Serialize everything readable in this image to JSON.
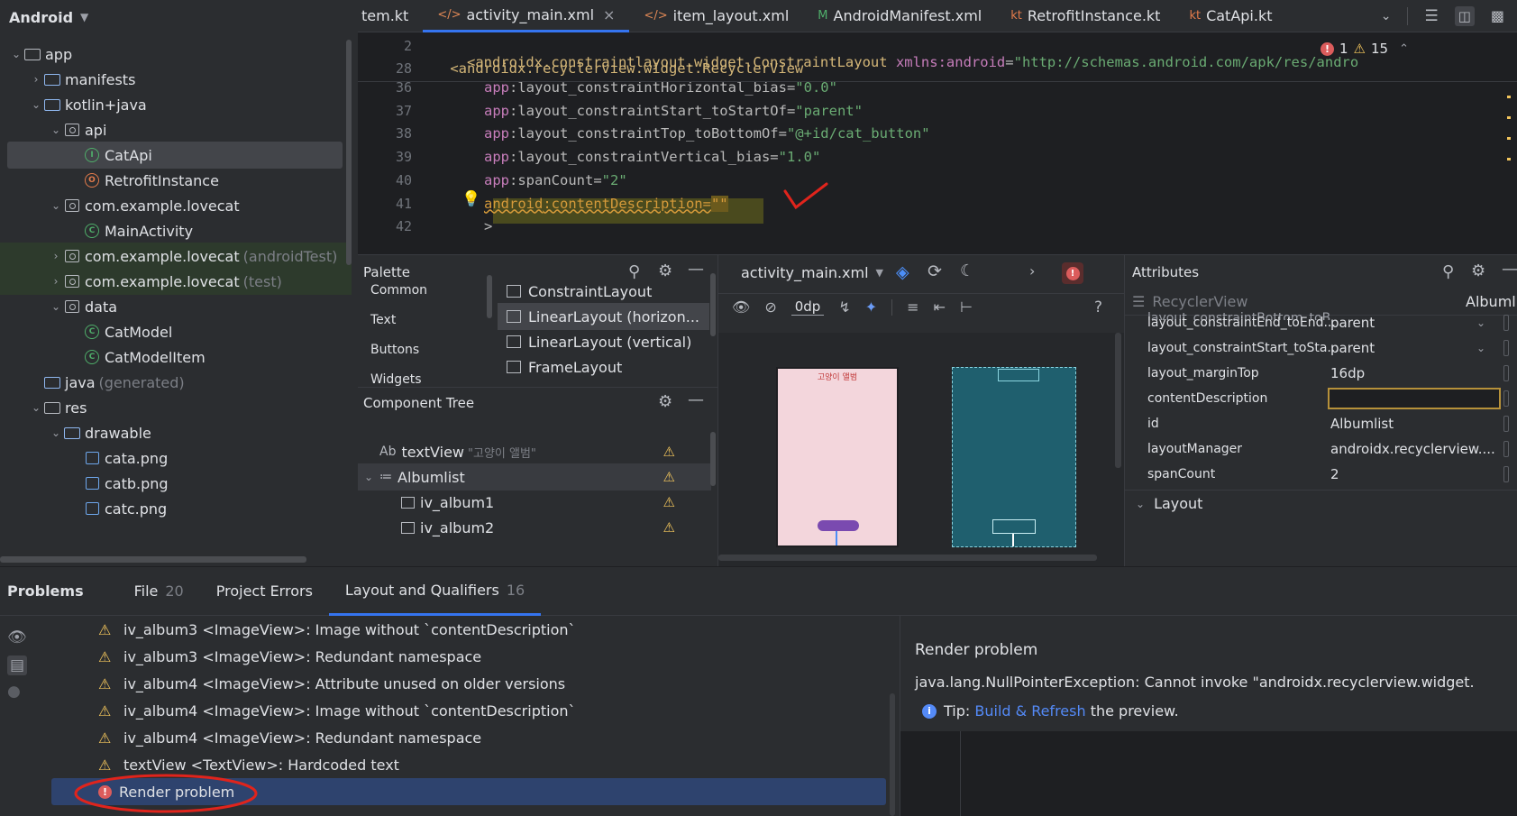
{
  "project": {
    "title": "Android",
    "tree": [
      {
        "label": "app",
        "depth": 0,
        "icon": "folder-module",
        "expanded": true,
        "bold": false
      },
      {
        "label": "manifests",
        "depth": 1,
        "icon": "folder",
        "expanded": false
      },
      {
        "label": "kotlin+java",
        "depth": 1,
        "icon": "folder",
        "expanded": true
      },
      {
        "label": "api",
        "depth": 2,
        "icon": "package",
        "expanded": true
      },
      {
        "label": "CatApi",
        "depth": 3,
        "icon": "kotlin-interface",
        "selected": true
      },
      {
        "label": "RetrofitInstance",
        "depth": 3,
        "icon": "kotlin-object"
      },
      {
        "label": "com.example.lovecat",
        "depth": 2,
        "icon": "package",
        "expanded": true
      },
      {
        "label": "MainActivity",
        "depth": 3,
        "icon": "kotlin-class"
      },
      {
        "label": "com.example.lovecat",
        "suffix": "(androidTest)",
        "depth": 2,
        "icon": "package",
        "expanded": false,
        "green": true
      },
      {
        "label": "com.example.lovecat",
        "suffix": "(test)",
        "depth": 2,
        "icon": "package",
        "expanded": false,
        "green": true
      },
      {
        "label": "data",
        "depth": 2,
        "icon": "package",
        "expanded": true
      },
      {
        "label": "CatModel",
        "depth": 3,
        "icon": "kotlin-class"
      },
      {
        "label": "CatModelItem",
        "depth": 3,
        "icon": "kotlin-class"
      },
      {
        "label": "java",
        "suffix": "(generated)",
        "depth": 1,
        "icon": "folder-generated"
      },
      {
        "label": "res",
        "depth": 1,
        "icon": "folder-res",
        "expanded": true
      },
      {
        "label": "drawable",
        "depth": 2,
        "icon": "folder",
        "expanded": true
      },
      {
        "label": "cata.png",
        "depth": 3,
        "icon": "image-file"
      },
      {
        "label": "catb.png",
        "depth": 3,
        "icon": "image-file"
      },
      {
        "label": "catc.png",
        "depth": 3,
        "icon": "image-file"
      }
    ]
  },
  "tabs": [
    {
      "label": "tem.kt",
      "icon": ""
    },
    {
      "label": "activity_main.xml",
      "icon": "</>",
      "active": true,
      "closable": true
    },
    {
      "label": "item_layout.xml",
      "icon": "</>"
    },
    {
      "label": "AndroidManifest.xml",
      "icon": "M"
    },
    {
      "label": "RetrofitInstance.kt",
      "icon": "kt"
    },
    {
      "label": "CatApi.kt",
      "icon": "kt"
    }
  ],
  "editor": {
    "sticky": [
      {
        "line": "2",
        "text": "<androidx.constraintlayout.widget.ConstraintLayout xmlns:android=\"http://schemas.android.com/apk/res/andro"
      },
      {
        "line": "28",
        "text": "    <androidx.recyclerview.widget.RecyclerView"
      }
    ],
    "lines": [
      {
        "line": "36",
        "ns": "app",
        "attr": ":layout_constraintHorizontal_bias=",
        "val": "\"0.0\""
      },
      {
        "line": "37",
        "ns": "app",
        "attr": ":layout_constraintStart_toStartOf=",
        "val": "\"parent\""
      },
      {
        "line": "38",
        "ns": "app",
        "attr": ":layout_constraintTop_toBottomOf=",
        "val": "\"@+id/cat_button\""
      },
      {
        "line": "39",
        "ns": "app",
        "attr": ":layout_constraintVertical_bias=",
        "val": "\"1.0\""
      },
      {
        "line": "40",
        "ns": "app",
        "attr": ":spanCount=",
        "val": "\"2\""
      },
      {
        "line": "41",
        "ns": "android",
        "attr": ":contentDescription=",
        "val": "\"\""
      },
      {
        "line": "42",
        "ns": "",
        "attr": ">",
        "val": ""
      }
    ],
    "errors": "1",
    "warnings": "15"
  },
  "palette": {
    "title": "Palette",
    "categories": [
      "Common",
      "Text",
      "Buttons",
      "Widgets"
    ],
    "items": [
      "ConstraintLayout",
      "LinearLayout (horizon...",
      "LinearLayout (vertical)",
      "FrameLayout"
    ]
  },
  "component_tree": {
    "title": "Component Tree",
    "items": [
      {
        "prefix": "Ab",
        "label": "textView",
        "hint": "\"고양이 앨범\"",
        "warn": true
      },
      {
        "prefix": "≔",
        "label": "Albumlist",
        "warn": true,
        "selected": true
      },
      {
        "prefix": "img",
        "label": "iv_album1",
        "warn": true
      },
      {
        "prefix": "img",
        "label": "iv_album2",
        "warn": true
      }
    ]
  },
  "design": {
    "file": "activity_main.xml",
    "zero_dp": "0dp",
    "help": "?",
    "preview_title": "고양이 앨범"
  },
  "attributes": {
    "title": "Attributes",
    "component": "RecyclerView",
    "component_id": "Albumlist",
    "rows": [
      {
        "name": "layout_constraintEnd_toEnd...",
        "value": "parent",
        "dropdown": true
      },
      {
        "name": "layout_constraintStart_toSta...",
        "value": "parent",
        "dropdown": true
      },
      {
        "name": "layout_marginTop",
        "value": "16dp"
      },
      {
        "name": "contentDescription",
        "value": "",
        "editing": true
      },
      {
        "name": "id",
        "value": "Albumlist"
      },
      {
        "name": "layoutManager",
        "value": "androidx.recyclerview...."
      },
      {
        "name": "spanCount",
        "value": "2"
      }
    ],
    "section": "Layout"
  },
  "problems": {
    "tabs": [
      {
        "label": "Problems",
        "count": ""
      },
      {
        "label": "File",
        "count": "20"
      },
      {
        "label": "Project Errors",
        "count": ""
      },
      {
        "label": "Layout and Qualifiers",
        "count": "16",
        "active": true
      }
    ],
    "rows": [
      {
        "text": "iv_album3 <ImageView>: Image without `contentDescription`",
        "type": "warn"
      },
      {
        "text": "iv_album3 <ImageView>: Redundant namespace",
        "type": "warn"
      },
      {
        "text": "iv_album4 <ImageView>: Attribute unused on older versions",
        "type": "warn"
      },
      {
        "text": "iv_album4 <ImageView>: Image without `contentDescription`",
        "type": "warn"
      },
      {
        "text": "iv_album4 <ImageView>: Redundant namespace",
        "type": "warn"
      },
      {
        "text": "textView <TextView>: Hardcoded text",
        "type": "warn"
      },
      {
        "text": "Render problem",
        "type": "error",
        "selected": true
      }
    ],
    "detail": {
      "title": "Render problem",
      "message": "java.lang.NullPointerException: Cannot invoke \"androidx.recyclerview.widget.",
      "tip_prefix": "Tip:",
      "tip_link": "Build & Refresh",
      "tip_suffix": "the preview."
    }
  },
  "colors": {
    "accent": "#3574f0",
    "warning": "#f2c55c",
    "error": "#db5c5c",
    "annotation": "#e0241c"
  }
}
